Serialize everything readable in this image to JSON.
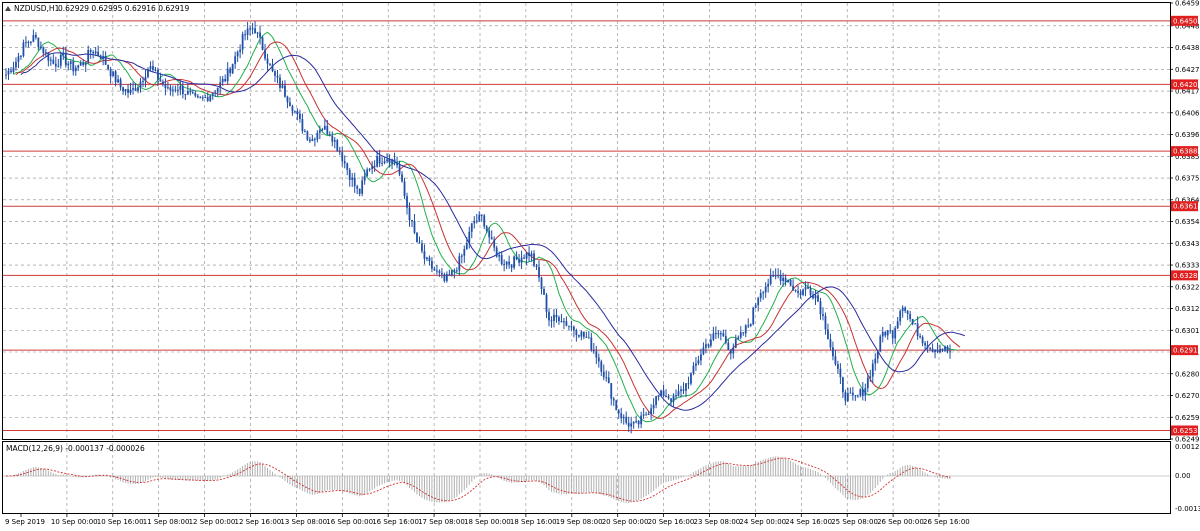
{
  "header": {
    "symbol_text": "NZDUSD,H1",
    "ohlc_text": "0.62929 0.62995 0.62916 0.62919"
  },
  "macd": {
    "label": "MACD(12,26,9) -0.000137 -0.000026",
    "axis_labels": [
      "0.001205",
      "0.00",
      "-0.00135"
    ]
  },
  "price_axis": {
    "labels": [
      "0.64595",
      "0.64485",
      "0.64380",
      "0.64275",
      "0.64170",
      "0.64065",
      "0.63960",
      "0.63855",
      "0.63750",
      "0.63645",
      "0.63540",
      "0.63435",
      "0.63330",
      "0.63225",
      "0.63120",
      "0.63015",
      "0.62910",
      "0.62805",
      "0.62700",
      "0.62595",
      "0.62490"
    ]
  },
  "levels": [
    {
      "text": "0.64509",
      "value": 0.64509
    },
    {
      "text": "0.64202",
      "value": 0.64202
    },
    {
      "text": "0.63880",
      "value": 0.6388
    },
    {
      "text": "0.63614",
      "value": 0.63614
    },
    {
      "text": "0.63280",
      "value": 0.6328
    },
    {
      "text": "0.62919",
      "value": 0.62919
    },
    {
      "text": "0.62531",
      "value": 0.62531
    }
  ],
  "time_axis": {
    "labels": [
      "9 Sep 2019",
      "10 Sep 00:00",
      "10 Sep 16:00",
      "11 Sep 08:00",
      "12 Sep 00:00",
      "12 Sep 16:00",
      "13 Sep 08:00",
      "16 Sep 00:00",
      "16 Sep 16:00",
      "17 Sep 08:00",
      "18 Sep 00:00",
      "18 Sep 16:00",
      "19 Sep 08:00",
      "20 Sep 00:00",
      "20 Sep 16:00",
      "23 Sep 08:00",
      "24 Sep 00:00",
      "24 Sep 16:00",
      "25 Sep 08:00",
      "26 Sep 00:00",
      "26 Sep 16:00"
    ]
  },
  "colors": {
    "candles": "#1f4fa8",
    "level_line": "#d03a3a",
    "level_tag": "#e02020",
    "ma_fast": "#23b04b",
    "ma_mid": "#c83232",
    "ma_slow": "#2a2aa0",
    "grid": "#8a8a8a",
    "macd_signal": "#d03030",
    "macd_hist": "#b0b0b0"
  },
  "chart_data": {
    "type": "line",
    "series": [
      {
        "name": "NZDUSD,H1",
        "values": [
          0.6425,
          0.6431,
          0.644,
          0.6443,
          0.6436,
          0.643,
          0.6433,
          0.6428,
          0.643,
          0.6437,
          0.6434,
          0.6426,
          0.6419,
          0.6416,
          0.6421,
          0.6429,
          0.6423,
          0.6417,
          0.6419,
          0.6416,
          0.6412,
          0.6414,
          0.6418,
          0.6423,
          0.6433,
          0.6444,
          0.6448,
          0.6437,
          0.6425,
          0.6418,
          0.641,
          0.64,
          0.6393,
          0.64,
          0.6397,
          0.6388,
          0.6377,
          0.6367,
          0.638,
          0.6384,
          0.6385,
          0.6382,
          0.6362,
          0.6345,
          0.6335,
          0.633,
          0.6325,
          0.633,
          0.6339,
          0.6354,
          0.6356,
          0.6342,
          0.6335,
          0.6334,
          0.6337,
          0.6339,
          0.6325,
          0.6306,
          0.6308,
          0.6304,
          0.6301,
          0.6297,
          0.6289,
          0.6277,
          0.6264,
          0.6257,
          0.6255,
          0.626,
          0.6268,
          0.6271,
          0.6268,
          0.6273,
          0.6281,
          0.6292,
          0.6298,
          0.63,
          0.6292,
          0.6298,
          0.6305,
          0.632,
          0.6325,
          0.6328,
          0.6326,
          0.6319,
          0.6322,
          0.6318,
          0.6303,
          0.6284,
          0.627,
          0.6268,
          0.6273,
          0.6286,
          0.6301,
          0.63,
          0.6315,
          0.6305,
          0.6298,
          0.6293,
          0.6293,
          0.6291
        ]
      }
    ],
    "ylim": [
      0.6249,
      0.64595
    ],
    "grid": true
  }
}
